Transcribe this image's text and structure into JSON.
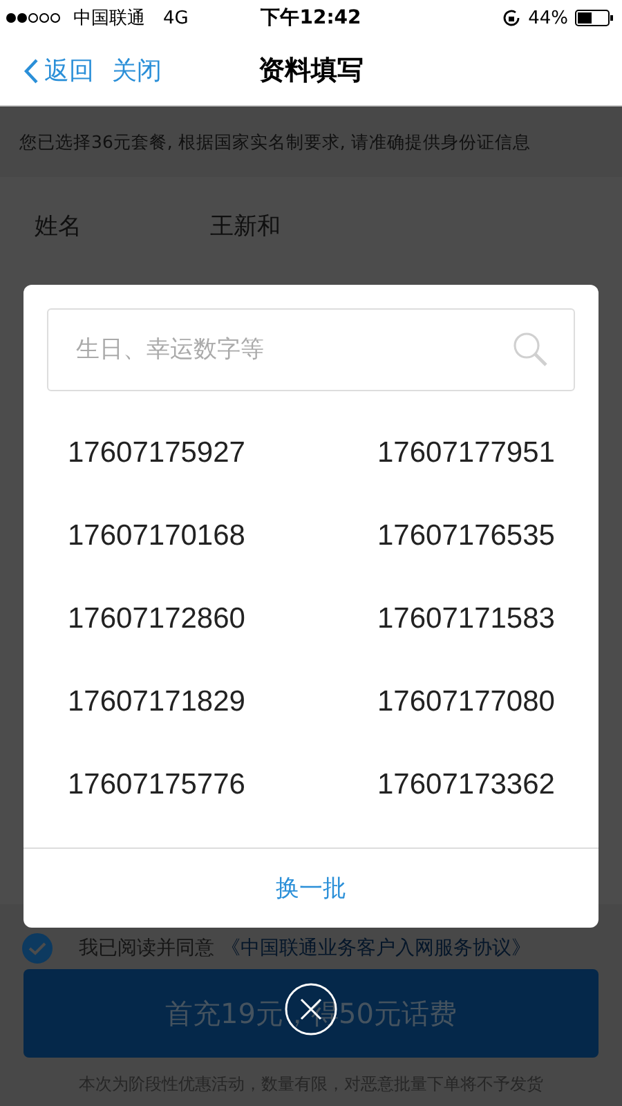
{
  "status_bar": {
    "carrier": "中国联通",
    "network": "4G",
    "time": "下午12:42",
    "battery": "44%"
  },
  "nav": {
    "back": "返回",
    "close": "关闭",
    "title": "资料填写"
  },
  "notice": "您已选择36元套餐, 根据国家实名制要求, 请准确提供身份证信息",
  "form": [
    {
      "label": "姓名",
      "value": "王新和"
    }
  ],
  "modal": {
    "search": {
      "placeholder": "生日、幸运数字等"
    },
    "numbers": [
      "17607175927",
      "17607177951",
      "17607170168",
      "17607176535",
      "17607172860",
      "17607171583",
      "17607171829",
      "17607177080",
      "17607175776",
      "17607173362"
    ],
    "refresh": "换一批"
  },
  "agreement": {
    "checked": true,
    "text": "我已阅读并同意",
    "link": "《中国联通业务客户入网服务协议》"
  },
  "submit": "首充19元，得50元话费",
  "footnote": "本次为阶段性优惠活动，数量有限，对恶意批量下单将不予发货"
}
